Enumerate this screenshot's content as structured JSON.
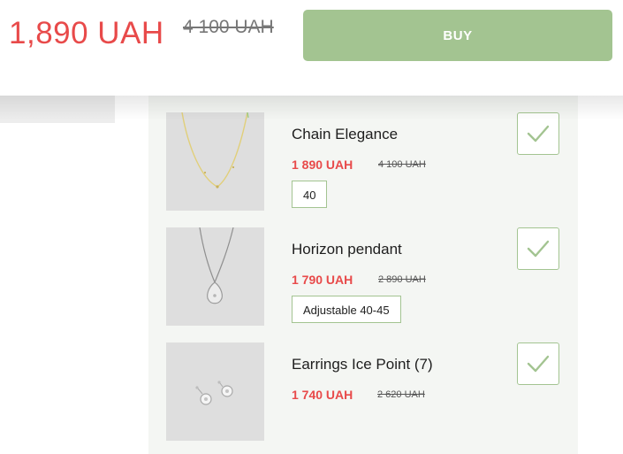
{
  "header": {
    "price": "1,890 UAH",
    "old_price": "4 100 UAH",
    "buy_label": "BUY"
  },
  "items": [
    {
      "title": "Chain Elegance",
      "price": "1 890 UAH",
      "old_price": "4 100 UAH",
      "size": "40",
      "checked": true,
      "image_icon": "gold-chain-necklace"
    },
    {
      "title": "Horizon pendant",
      "price": "1 790 UAH",
      "old_price": "2 890 UAH",
      "size": "Adjustable 40-45",
      "checked": true,
      "image_icon": "silver-pendant-necklace"
    },
    {
      "title": "Earrings Ice Point (7)",
      "price": "1 740 UAH",
      "old_price": "2 620 UAH",
      "checked": true,
      "image_icon": "crystal-stud-earrings"
    }
  ],
  "colors": {
    "accent_green": "#a3c491",
    "price_red": "#e84a4a",
    "panel_bg": "#f4f6f3"
  }
}
